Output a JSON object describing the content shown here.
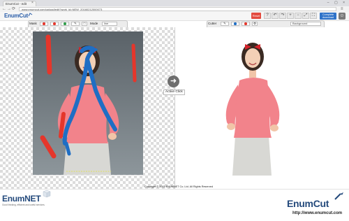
{
  "browser": {
    "tab_title": "EnumCut - edit",
    "url": "www.enumcut.com/upload/edit?work_id=NEW_20160212000073",
    "tab_close": "×",
    "window_buttons": "– ▢ ×",
    "menu": "≡"
  },
  "header": {
    "logo": "EnumCut",
    "reset_label": "Reset",
    "complete_label": "Complete",
    "complete_sub": "download",
    "icons": [
      "help-icon",
      "undo-icon",
      "redo-icon",
      "zoom-in-icon",
      "zoom-out-icon",
      "fit-icon",
      "expand-icon",
      "compare-icon"
    ],
    "icon_glyphs": [
      "?",
      "↶",
      "↷",
      "+",
      "−",
      "⤢",
      "⛶",
      "⇄"
    ]
  },
  "left_toolbar": {
    "mask_label": "Mask",
    "mode_label": "Mode",
    "mode_value": "line",
    "red_tool": "●",
    "green_tool": "●",
    "eraser_tool": "✎"
  },
  "right_toolbar": {
    "cutter_label": "Cutter",
    "background_value": "Background",
    "blue_tool": "●",
    "red_tool": "●"
  },
  "canvas": {
    "active_click_label": "Active Click",
    "arrow_glyph": "➜"
  },
  "footer": {
    "enumnet_logo": "EnumNET",
    "enumnet_tagline": "Good thinking, efficient and useful services.",
    "copyright": "Copyright © 2015 ENUMNET Co. Ltd. All Rights Reserved",
    "enumcut_logo": "EnumCut",
    "enumcut_url": "http://www.enumcut.com"
  },
  "colors": {
    "brand": "#244a7c",
    "reset": "#e34b3f",
    "complete": "#2f73c9",
    "mask_red": "#e5362b",
    "mask_blue": "#1f6ec4",
    "sweater": "#f2838b"
  }
}
